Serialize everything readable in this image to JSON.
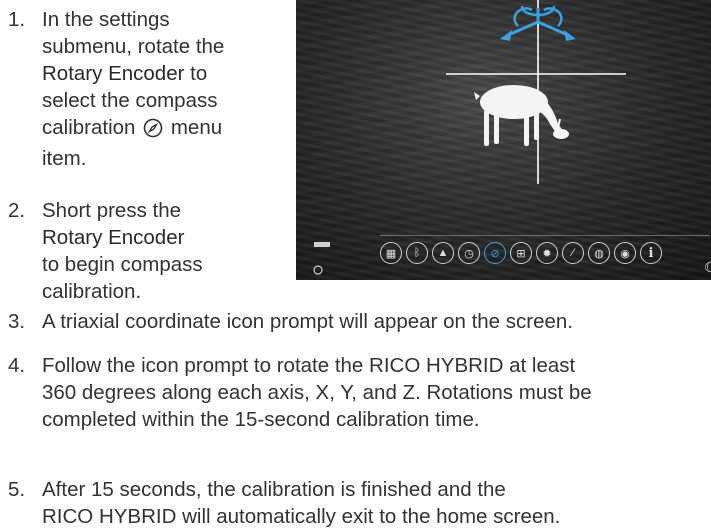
{
  "steps": [
    {
      "num": "1.",
      "parts": [
        "In the settings",
        "submenu, rotate the",
        "Rotary Encoder",
        "to",
        "select the compass",
        "calibration",
        "menu",
        "item."
      ]
    },
    {
      "num": "2.",
      "parts": [
        "Short press the",
        "Rotary Encoder",
        "to begin compass",
        "calibration."
      ]
    },
    {
      "num": "3.",
      "text": "A triaxial coordinate icon prompt will appear on the screen."
    },
    {
      "num": "4.",
      "lines": [
        "Follow the icon prompt to rotate the RICO HYBRID at least",
        "360 degrees along each axis, X, Y, and Z. Rotations must be",
        "completed within the 15-second calibration time."
      ]
    },
    {
      "num": "5.",
      "lines": [
        "After 15 seconds, the calibration is finished and the",
        "RICO HYBRID will automatically exit to the home screen."
      ]
    }
  ],
  "icons": {
    "compass": "compass-icon",
    "rotation_prompt": "triaxial-rotation-icon",
    "info": "i"
  },
  "colors": {
    "accent": "#3aa0e0",
    "text": "#333333"
  }
}
